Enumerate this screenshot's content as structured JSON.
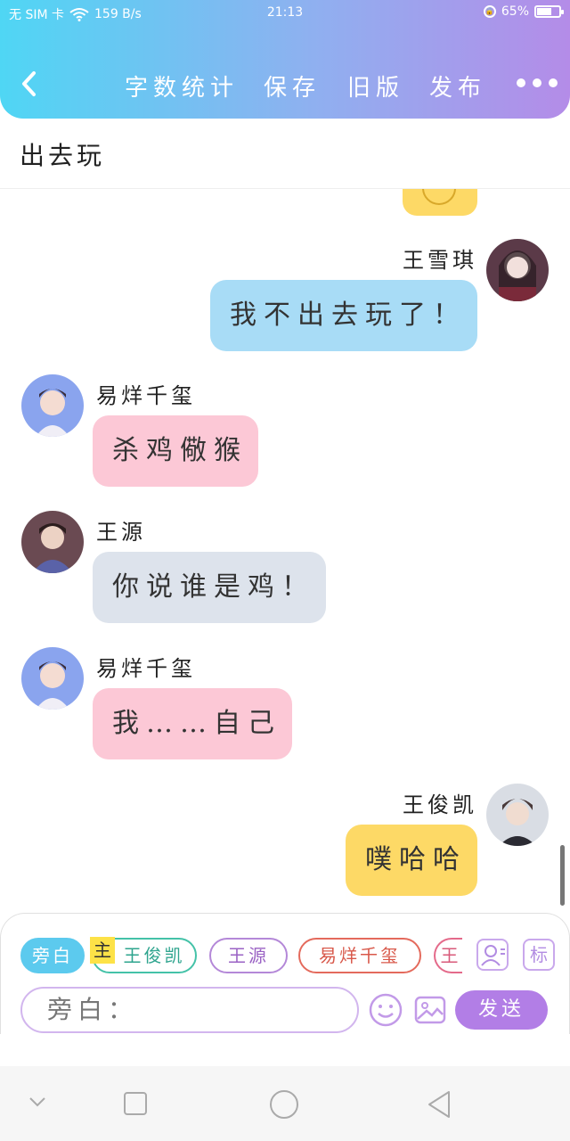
{
  "status_bar": {
    "carrier": "无 SIM 卡",
    "speed": "159 B/s",
    "time": "21:13",
    "battery": "65%",
    "battery_level": 0.65
  },
  "toolbar": {
    "word_count": "字数统计",
    "save": "保存",
    "old_version": "旧版",
    "publish": "发布"
  },
  "story": {
    "title": "出去玩"
  },
  "messages": [
    {
      "side": "right",
      "sender": "王雪琪",
      "text": "我不出去玩了！",
      "color": "#a8dcf6"
    },
    {
      "side": "left",
      "sender": "易烊千玺",
      "text": "杀鸡儆猴",
      "color": "#fcc8d6"
    },
    {
      "side": "left",
      "sender": "王源",
      "text": "你说谁是鸡！",
      "color": "#dde3ec"
    },
    {
      "side": "left",
      "sender": "易烊千玺",
      "text": "我……自己",
      "color": "#fcc8d6"
    },
    {
      "side": "right",
      "sender": "王俊凯",
      "text": "噗哈哈",
      "color": "#fdd966"
    }
  ],
  "composer": {
    "chips": {
      "narration": "旁白",
      "main_tag": "主",
      "wjk": "王俊凯",
      "wy": "王源",
      "yyqx": "易烊千玺",
      "partial": "王"
    },
    "tag_icon_label": "标",
    "input_value": "旁白：",
    "send": "发送"
  },
  "colors": {
    "header_start": "#4fd6f4",
    "header_end": "#b48ce8",
    "send_button": "#b27ee6"
  }
}
